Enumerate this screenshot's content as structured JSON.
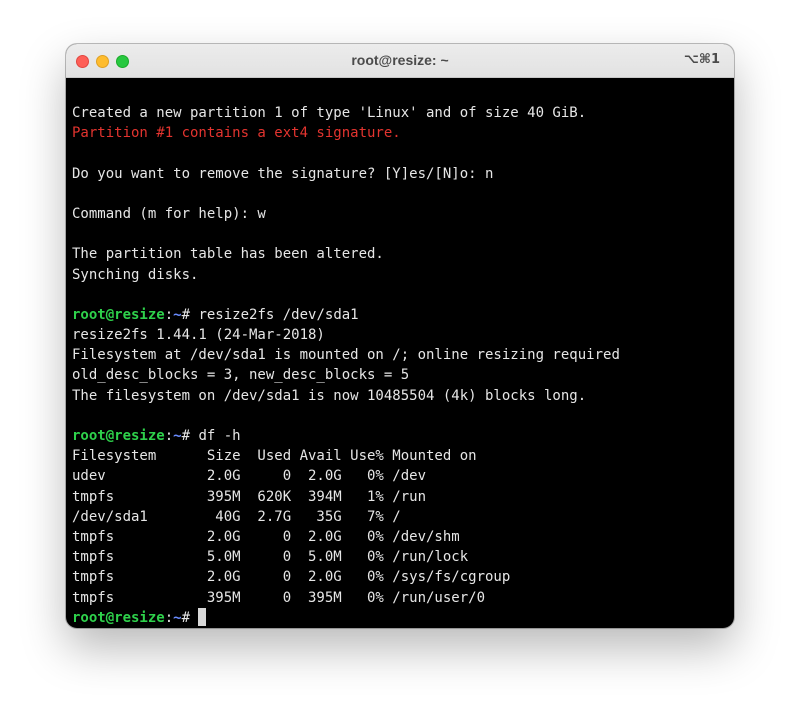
{
  "window": {
    "title": "root@resize: ~",
    "shortcut": "⌥⌘1"
  },
  "colors": {
    "terminal_bg": "#000000",
    "text": "#e6e6e6",
    "error": "#e3342f",
    "prompt_user": "#2ed14b",
    "prompt_path": "#6a8cff"
  },
  "prompt": {
    "user_host": "root@resize",
    "separator": ":",
    "path": "~",
    "symbol": "# "
  },
  "output": {
    "created": "Created a new partition 1 of type 'Linux' and of size 40 GiB.",
    "signature_warning": "Partition #1 contains a ext4 signature.",
    "remove_signature": "Do you want to remove the signature? [Y]es/[N]o: n",
    "command": "Command (m for help): w",
    "altered": "The partition table has been altered.",
    "synching": "Synching disks.",
    "resize_cmd": "resize2fs /dev/sda1",
    "resize_version": "resize2fs 1.44.1 (24-Mar-2018)",
    "resize_mounted": "Filesystem at /dev/sda1 is mounted on /; online resizing required",
    "resize_blocks": "old_desc_blocks = 3, new_desc_blocks = 5",
    "resize_done": "The filesystem on /dev/sda1 is now 10485504 (4k) blocks long.",
    "df_cmd": "df -h",
    "df_header": "Filesystem      Size  Used Avail Use% Mounted on",
    "df_rows": [
      "udev            2.0G     0  2.0G   0% /dev",
      "tmpfs           395M  620K  394M   1% /run",
      "/dev/sda1        40G  2.7G   35G   7% /",
      "tmpfs           2.0G     0  2.0G   0% /dev/shm",
      "tmpfs           5.0M     0  5.0M   0% /run/lock",
      "tmpfs           2.0G     0  2.0G   0% /sys/fs/cgroup",
      "tmpfs           395M     0  395M   0% /run/user/0"
    ]
  }
}
